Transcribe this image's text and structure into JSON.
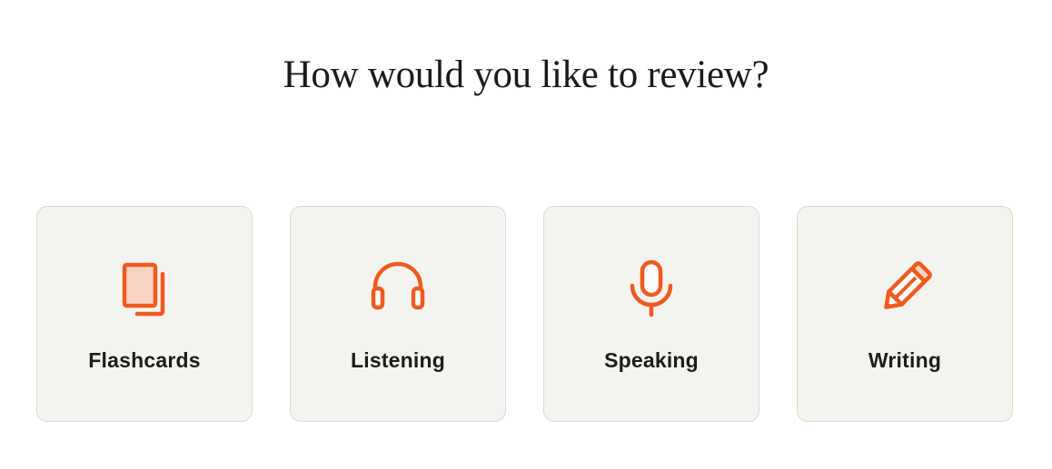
{
  "page": {
    "title": "How would you like to review?"
  },
  "colors": {
    "accent": "#f05a1e",
    "accent_fill": "#f9d3c3",
    "card_bg": "#f5f3ee",
    "card_border": "#dcd9d2"
  },
  "options": [
    {
      "label": "Flashcards",
      "icon": "flashcards-icon"
    },
    {
      "label": "Listening",
      "icon": "headphones-icon"
    },
    {
      "label": "Speaking",
      "icon": "microphone-icon"
    },
    {
      "label": "Writing",
      "icon": "pencil-icon"
    }
  ]
}
